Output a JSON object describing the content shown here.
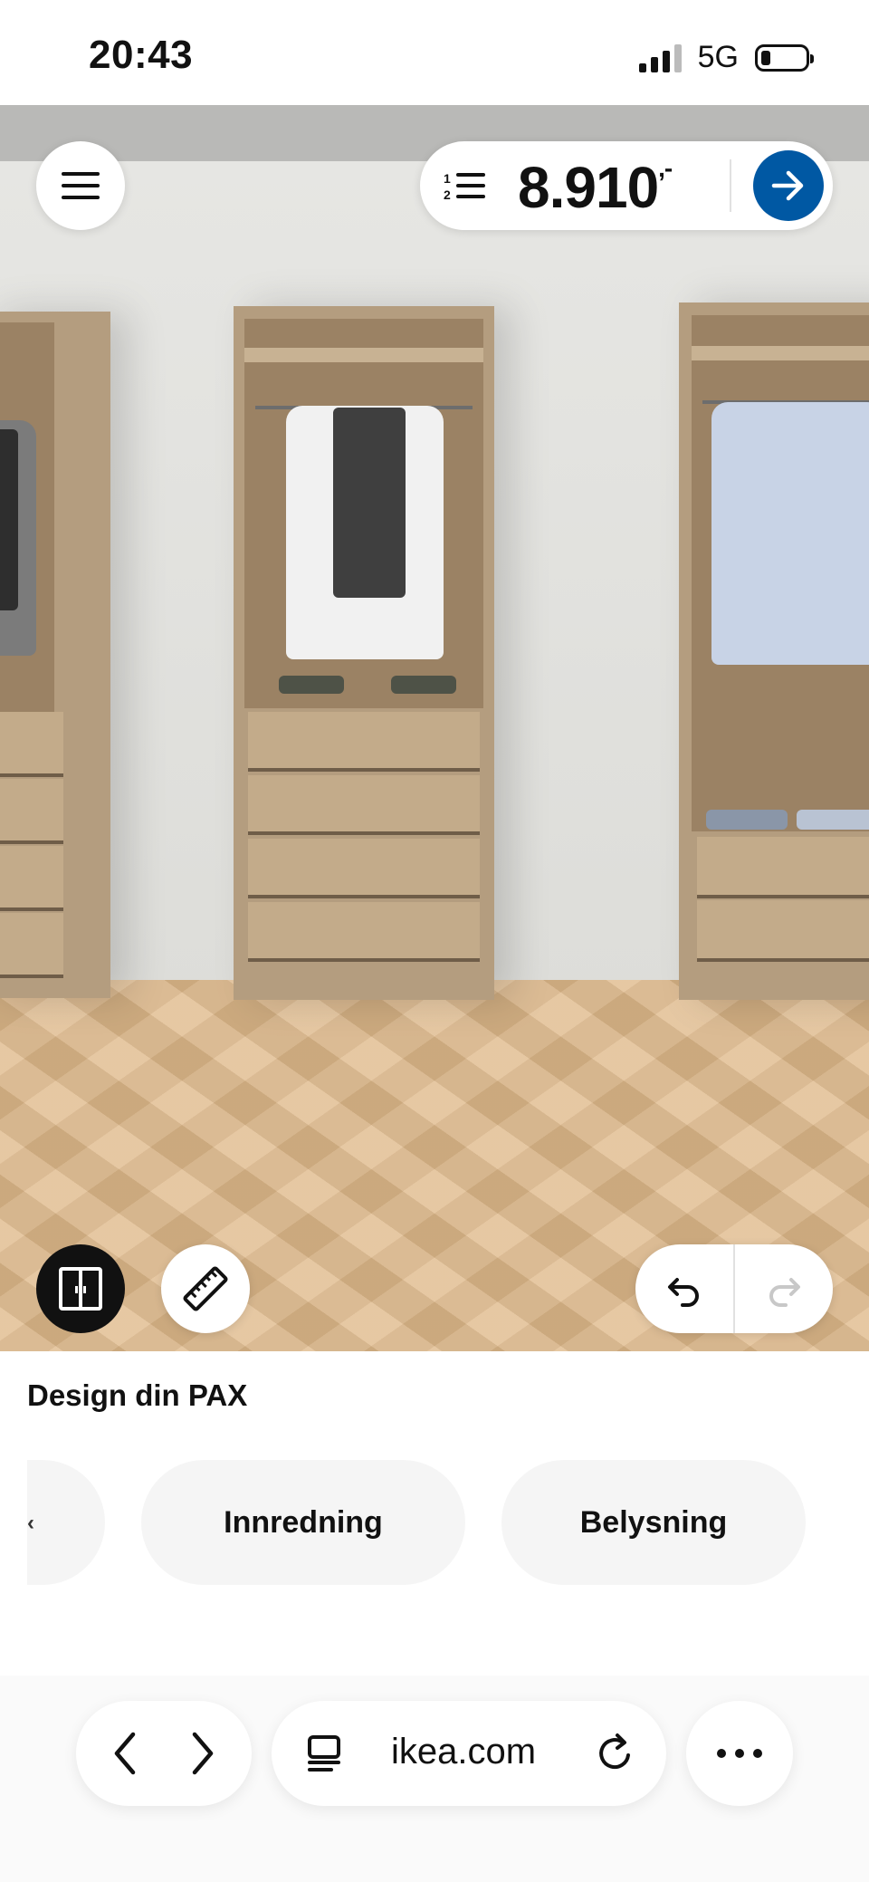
{
  "status_bar": {
    "time": "20:43",
    "network": "5G",
    "signal_icon": "cellular-signal-icon",
    "battery_icon": "battery-low-icon"
  },
  "planner": {
    "menu_icon": "hamburger-menu-icon",
    "list_icon": "numbered-list-icon",
    "price": "8.910",
    "price_suffix": ",-",
    "go_icon": "arrow-right-icon",
    "accent_color": "#0058a3",
    "door_toggle_icon": "wardrobe-doors-icon",
    "measure_icon": "ruler-icon",
    "undo_icon": "undo-icon",
    "redo_icon": "redo-icon"
  },
  "panel": {
    "title": "Design din PAX",
    "chips": [
      "Innredning",
      "Belysning"
    ]
  },
  "browser": {
    "url": "ikea.com",
    "back_icon": "chevron-left-icon",
    "forward_icon": "chevron-right-icon",
    "tabs_icon": "tabs-icon",
    "reload_icon": "reload-icon",
    "more_icon": "more-dots-icon"
  }
}
